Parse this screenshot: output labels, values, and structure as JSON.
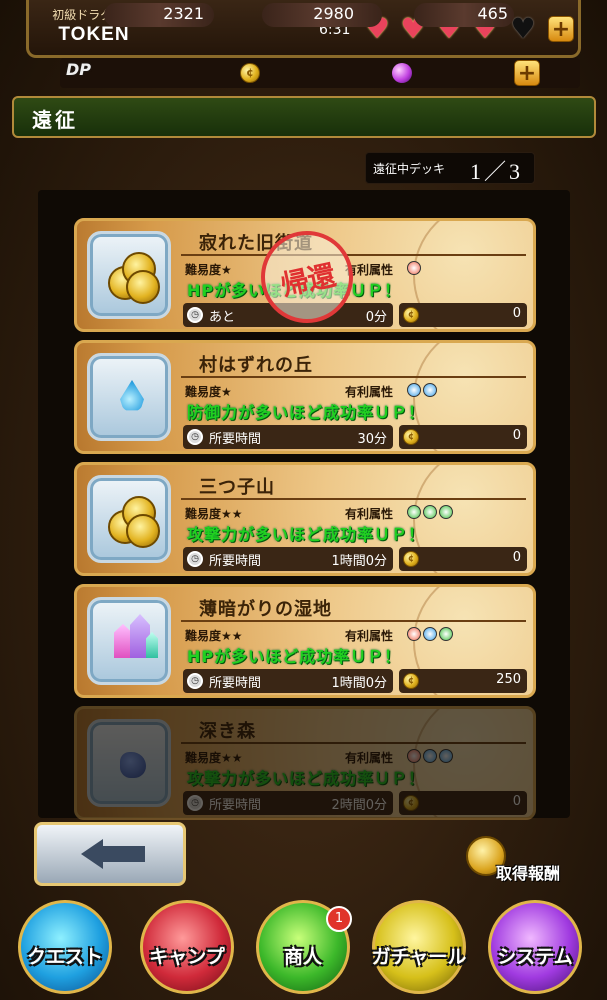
{
  "header": {
    "rank": "初級ドラグーン",
    "username": "TOKEN",
    "clock": "6:31",
    "hearts_full": 4,
    "hearts_total": 5,
    "dp_label": "DP",
    "dp_value": "2321",
    "coin_value": "2980",
    "orb_value": "465",
    "plus_label": "+"
  },
  "page_title": "遠征",
  "deck": {
    "label": "遠征中デッキ",
    "count": "1／3"
  },
  "common": {
    "difficulty_label": "難易度",
    "attr_label": "有利属性",
    "required_time_label": "所要時間",
    "remaining_label": "あと",
    "coin_glyph": "¢",
    "clock_glyph": "◷"
  },
  "expeditions": [
    {
      "name": "寂れた旧街道",
      "stars": "★",
      "attrs": [
        "fire"
      ],
      "desc": "HPが多いほど成功率ＵＰ！",
      "time_label": "あと",
      "time": "0分",
      "reward": "0",
      "icon": "coins-icon",
      "stamp": "帰還"
    },
    {
      "name": "村はずれの丘",
      "stars": "★",
      "attrs": [
        "water",
        "water"
      ],
      "desc": "防御力が多いほど成功率ＵＰ！",
      "time_label": "所要時間",
      "time": "30分",
      "reward": "0",
      "icon": "water-drop-icon"
    },
    {
      "name": "三つ子山",
      "stars": "★★",
      "attrs": [
        "wind",
        "wind",
        "wind"
      ],
      "desc": "攻撃力が多いほど成功率ＵＰ！",
      "time_label": "所要時間",
      "time": "1時間0分",
      "reward": "0",
      "icon": "coins-icon"
    },
    {
      "name": "薄暗がりの湿地",
      "stars": "★★",
      "attrs": [
        "fire",
        "water",
        "wind"
      ],
      "desc": "HPが多いほど成功率ＵＰ！",
      "time_label": "所要時間",
      "time": "1時間0分",
      "reward": "250",
      "icon": "crystal-icon"
    },
    {
      "name": "深き森",
      "stars": "★★",
      "attrs": [
        "fire",
        "water",
        "water"
      ],
      "desc": "攻撃力が多いほど成功率ＵＰ！",
      "time_label": "所要時間",
      "time": "2時間0分",
      "reward": "0",
      "icon": "ore-icon"
    }
  ],
  "reward_button": "取得報酬",
  "nav": {
    "quest": "クエスト",
    "camp": "キャンプ",
    "merchant": "商人",
    "merchant_badge": "1",
    "gacha": "ガチャール",
    "system": "システム"
  },
  "colors": {
    "accent_gold": "#e0b64a",
    "success_green": "#20d020",
    "stamp_red": "#e03838"
  }
}
